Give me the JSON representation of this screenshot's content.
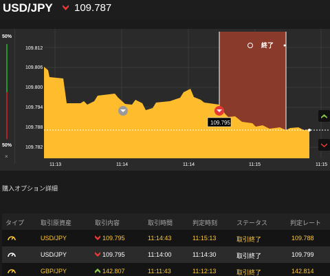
{
  "header": {
    "pair": "USD/JPY",
    "rate": "109.787",
    "rate_direction_icon": "arrow-down-icon"
  },
  "percent_panel": {
    "top": "50%",
    "bottom": "50%",
    "close": "×"
  },
  "chart": {
    "y_ticks": [
      "109.812",
      "109.806",
      "109.800",
      "109.794",
      "109.788",
      "109.782"
    ],
    "x_ticks": [
      "11:13",
      "11:14",
      "11:14",
      "11:15",
      "11:15"
    ],
    "price_label": "109.795",
    "expiry_label": "終了",
    "colors": {
      "area": "#ffbd2e",
      "expiry_zone": "#8a3a2a",
      "background": "#2a2a2a"
    }
  },
  "section": {
    "title": "購入オプション詳細"
  },
  "table": {
    "headers": [
      "タイプ",
      "取引原資産",
      "取引内容",
      "取引時間",
      "判定時刻",
      "ステータス",
      "判定レート"
    ],
    "rows": [
      {
        "asset": "USD/JPY",
        "content": "109.795",
        "direction": "down",
        "trade_time": "11:14:43",
        "judge_time": "11:15:13",
        "status": "取引終了",
        "judge_rate": "109.788",
        "white": false
      },
      {
        "asset": "USD/JPY",
        "content": "109.795",
        "direction": "down",
        "trade_time": "11:14:00",
        "judge_time": "11:14:30",
        "status": "取引終了",
        "judge_rate": "109.799",
        "white": true
      },
      {
        "asset": "GBP/JPY",
        "content": "142.807",
        "direction": "up",
        "trade_time": "11:11:43",
        "judge_time": "11:12:13",
        "status": "取引終了",
        "judge_rate": "142.814",
        "white": false
      }
    ]
  }
}
